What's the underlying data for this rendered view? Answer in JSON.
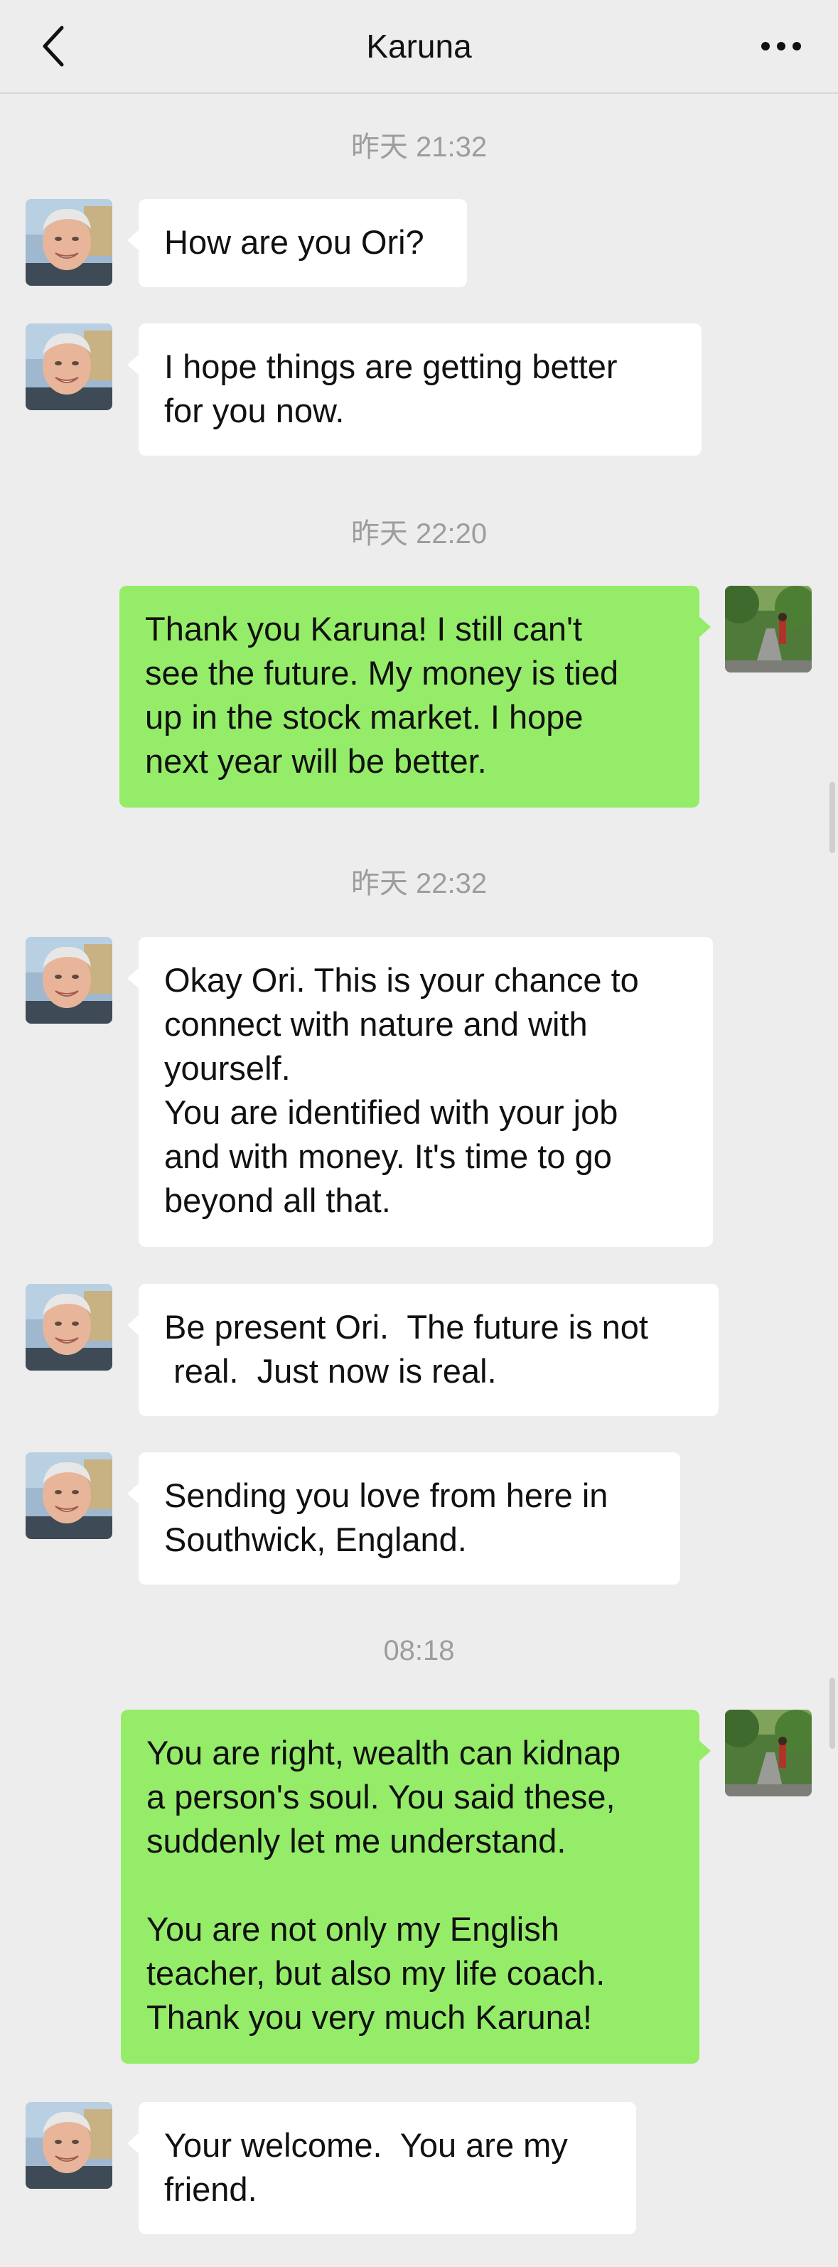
{
  "header": {
    "title": "Karuna",
    "back_icon": "chevron-left-icon",
    "more_icon": "more-dots-icon"
  },
  "colors": {
    "background": "#ededed",
    "incoming_bubble": "#ffffff",
    "outgoing_bubble": "#95ec69",
    "timestamp": "#9d9d9d"
  },
  "conversation": {
    "timestamps": [
      "昨天 21:32",
      "昨天 22:20",
      "昨天 22:32",
      "08:18"
    ],
    "messages": [
      {
        "sender": "Karuna",
        "direction": "incoming",
        "text": "How are you Ori?"
      },
      {
        "sender": "Karuna",
        "direction": "incoming",
        "text": "I hope things are getting better\nfor you now."
      },
      {
        "sender": "me",
        "direction": "outgoing",
        "text": "Thank you Karuna! I still can't\nsee the future. My money is tied\nup in the stock market. I hope\nnext year will be better."
      },
      {
        "sender": "Karuna",
        "direction": "incoming",
        "text": "Okay Ori. This is your chance to\nconnect with nature and with\nyourself.\nYou are identified with your job\nand with money. It's time to go\nbeyond all that."
      },
      {
        "sender": "Karuna",
        "direction": "incoming",
        "text": "Be present Ori.  The future is not\n real.  Just now is real."
      },
      {
        "sender": "Karuna",
        "direction": "incoming",
        "text": "Sending you love from here in\nSouthwick, England."
      },
      {
        "sender": "me",
        "direction": "outgoing",
        "text": "You are right, wealth can kidnap\na person's soul. You said these,\nsuddenly let me understand.\n\nYou are not only my English\nteacher, but also my life coach.\nThank you very much Karuna!"
      },
      {
        "sender": "Karuna",
        "direction": "incoming",
        "text": "Your welcome.  You are my\nfriend."
      }
    ]
  }
}
